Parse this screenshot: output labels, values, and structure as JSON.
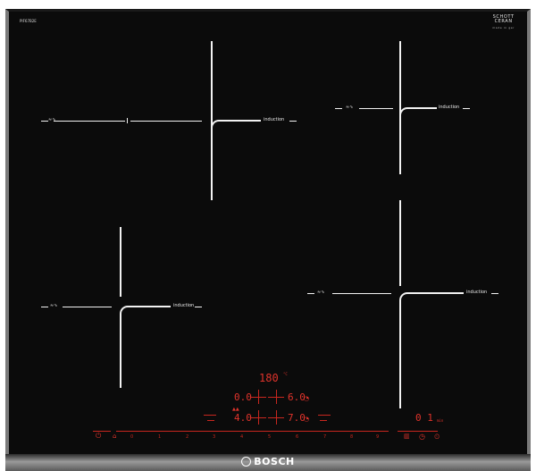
{
  "model_code": "PIF67B2E",
  "glass": {
    "line1": "SCHOTT",
    "line2": "CERAN",
    "sub": "made in ger"
  },
  "brand": "BOSCH",
  "zones": {
    "top_left": {
      "wave": "≈∿",
      "label": "induction"
    },
    "top_right": {
      "wave": "≈∿",
      "label": "induction"
    },
    "bottom_left": {
      "wave": "≈∿",
      "label": "induction"
    },
    "bottom_right": {
      "wave": "≈∿",
      "label": "induction"
    }
  },
  "display": {
    "temperature": "180",
    "temperature_unit": "°C",
    "top_left_value": "0.0",
    "top_right_value": "6.0",
    "bottom_left_value": "4.0",
    "bottom_right_value": "7.0",
    "timer": "0 1",
    "timer_unit": "min"
  },
  "slider": {
    "ticks": [
      "0",
      "1",
      "2",
      "3",
      "4",
      "5",
      "6",
      "7",
      "8",
      "9"
    ]
  },
  "icons": [
    "power-icon",
    "child-lock-icon",
    "wipe-protect-icon",
    "timer-icon",
    "stopwatch-icon",
    "boost-icon",
    "keep-warm-icon"
  ],
  "colors": {
    "accent": "#e0332b",
    "glass": "#0b0b0b",
    "trim": "#7a7a7a"
  }
}
